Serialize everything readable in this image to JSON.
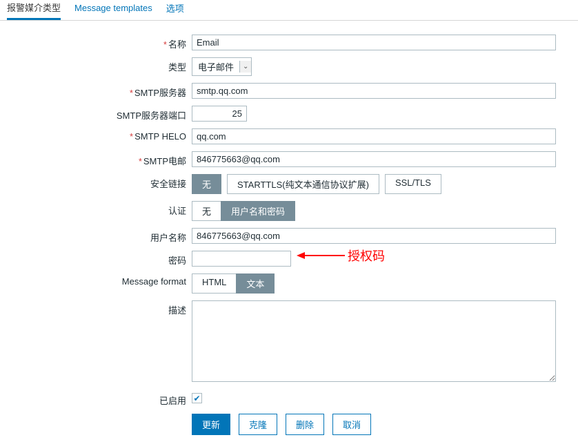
{
  "tabs": {
    "t0": "报警媒介类型",
    "t1": "Message templates",
    "t2": "选项"
  },
  "labels": {
    "name": "名称",
    "type": "类型",
    "smtp_server": "SMTP服务器",
    "smtp_port": "SMTP服务器端口",
    "smtp_helo": "SMTP HELO",
    "smtp_email": "SMTP电邮",
    "ssl": "安全链接",
    "auth": "认证",
    "username": "用户名称",
    "password": "密码",
    "msg_format": "Message format",
    "desc": "描述",
    "enabled": "已启用"
  },
  "values": {
    "name": "Email",
    "type": "电子邮件",
    "smtp_server": "smtp.qq.com",
    "smtp_port": "25",
    "smtp_helo": "qq.com",
    "smtp_email": "846775663@qq.com",
    "username": "846775663@qq.com",
    "password": "",
    "desc": ""
  },
  "ssl_opts": {
    "none": "无",
    "starttls": "STARTTLS(纯文本通信协议扩展)",
    "ssltls": "SSL/TLS"
  },
  "auth_opts": {
    "none": "无",
    "userpass": "用户名和密码"
  },
  "fmt_opts": {
    "html": "HTML",
    "text": "文本"
  },
  "actions": {
    "update": "更新",
    "clone": "克隆",
    "delete": "删除",
    "cancel": "取消"
  },
  "annotation": "授权码"
}
